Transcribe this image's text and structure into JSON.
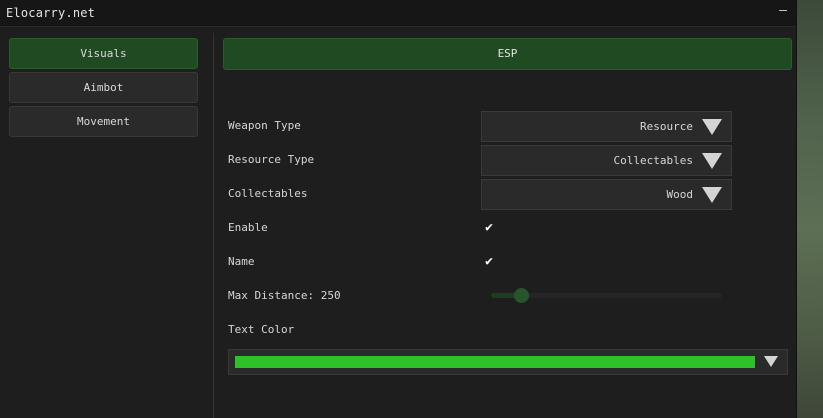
{
  "window": {
    "title": "Elocarry.net",
    "collapse_glyph": "–"
  },
  "sidebar": {
    "items": [
      {
        "label": "Visuals",
        "active": true
      },
      {
        "label": "Aimbot",
        "active": false
      },
      {
        "label": "Movement",
        "active": false
      }
    ]
  },
  "main": {
    "tab": {
      "label": "ESP"
    },
    "weapon_type": {
      "label": "Weapon Type",
      "value": "Resource"
    },
    "resource_type": {
      "label": "Resource Type",
      "value": "Collectables"
    },
    "collectables": {
      "label": "Collectables",
      "value": "Wood"
    },
    "enable": {
      "label": "Enable",
      "checked": true,
      "glyph": "✔"
    },
    "name": {
      "label": "Name",
      "checked": true,
      "glyph": "✔"
    },
    "max_distance": {
      "label": "Max Distance: 250",
      "value": 250,
      "fraction": 0.13
    },
    "text_color": {
      "label": "Text Color",
      "color": "#2ec12a"
    }
  },
  "colors": {
    "accent": "#1f4a22",
    "swatch": "#2ec12a"
  }
}
